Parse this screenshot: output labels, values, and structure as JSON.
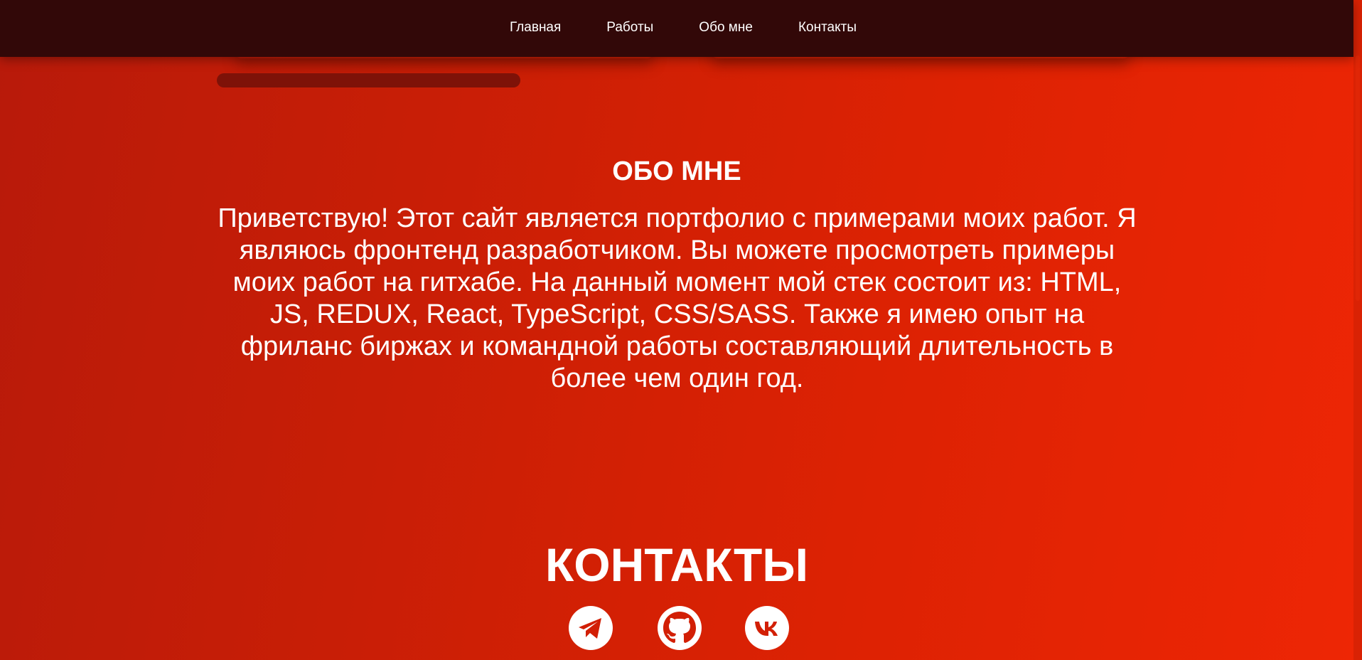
{
  "nav": {
    "items": [
      {
        "label": "Главная"
      },
      {
        "label": "Работы"
      },
      {
        "label": "Обо мне"
      },
      {
        "label": "Контакты"
      }
    ]
  },
  "about": {
    "title": "ОБО МНЕ",
    "text": "Приветствую! Этот сайт является портфолио с примерами моих работ. Я являюсь фронтенд разработчиком. Вы можете просмотреть примеры моих работ на гитхабе. На данный момент мой стек состоит из: HTML, JS, REDUX, React, TypeScript, CSS/SASS. Также я имею опыт на фриланс биржах и командной работы составляющий длительность в более чем один год."
  },
  "contacts": {
    "title": "КОНТАКТЫ",
    "icons": [
      "telegram-icon",
      "github-icon",
      "vk-icon"
    ]
  },
  "colors": {
    "navbar": "#320808",
    "background_start": "#b81a0a",
    "background_end": "#ee2605",
    "text": "#ffffff"
  }
}
